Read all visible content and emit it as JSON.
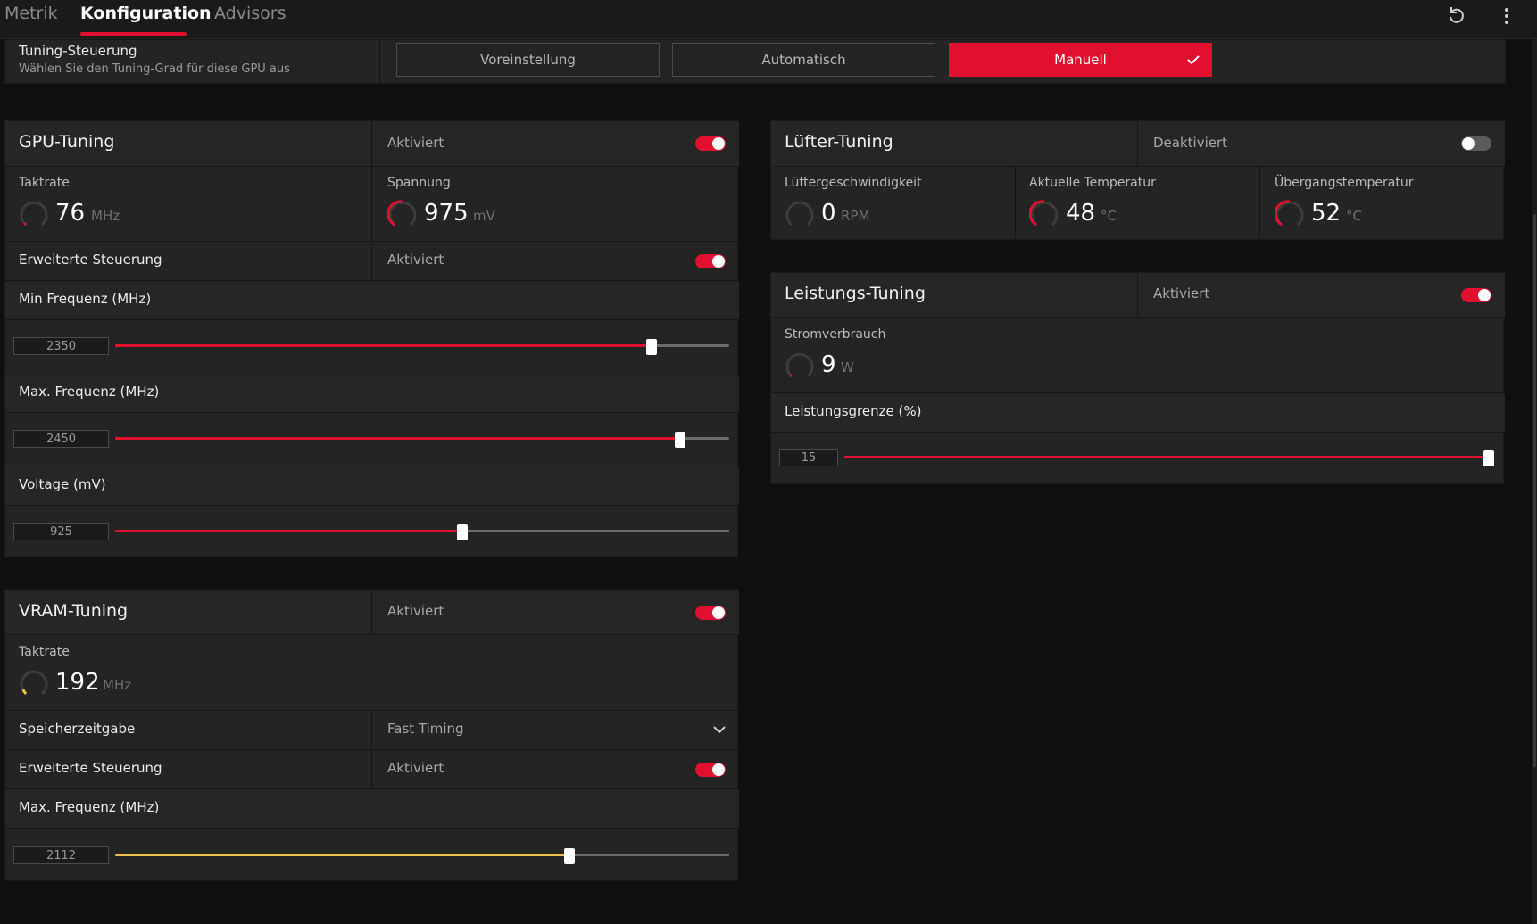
{
  "tabs": [
    {
      "label": "Metrik",
      "active": false
    },
    {
      "label": "Konfiguration",
      "active": true
    },
    {
      "label": "Advisors",
      "active": false
    }
  ],
  "top_icons": [
    "reset-icon",
    "more-vertical-icon"
  ],
  "tuning_control": {
    "title": "Tuning-Steuerung",
    "subtitle": "Wählen Sie den Tuning-Grad für diese GPU aus",
    "options": [
      "Voreinstellung",
      "Automatisch",
      "Manuell"
    ],
    "selected": "Manuell"
  },
  "gpu_tuning": {
    "title": "GPU-Tuning",
    "status": "Aktiviert",
    "enabled": true,
    "clock": {
      "label": "Taktrate",
      "value": "76",
      "unit": "MHz",
      "level": 0.03
    },
    "voltage": {
      "label": "Spannung",
      "value": "975",
      "unit": "mV",
      "level": 0.5
    },
    "advanced": {
      "label": "Erweiterte Steuerung",
      "status": "Aktiviert",
      "enabled": true
    },
    "min_freq": {
      "label": "Min Frequenz (MHz)",
      "value": "2350",
      "fraction": 0.873
    },
    "max_freq": {
      "label": "Max. Frequenz (MHz)",
      "value": "2450",
      "fraction": 0.92
    },
    "voltage_slider": {
      "label": "Voltage (mV)",
      "value": "925",
      "fraction": 0.565
    }
  },
  "vram_tuning": {
    "title": "VRAM-Tuning",
    "status": "Aktiviert",
    "enabled": true,
    "clock": {
      "label": "Taktrate",
      "value": "192",
      "unit": "MHz",
      "level": 0.08
    },
    "memory_timing": {
      "label": "Speicherzeitgabe",
      "value": "Fast Timing"
    },
    "advanced": {
      "label": "Erweiterte Steuerung",
      "status": "Aktiviert",
      "enabled": true
    },
    "max_freq": {
      "label": "Max. Frequenz (MHz)",
      "value": "2112",
      "fraction": 0.74
    }
  },
  "fan_tuning": {
    "title": "Lüfter-Tuning",
    "status": "Deaktiviert",
    "enabled": false,
    "fan_speed": {
      "label": "Lüftergeschwindigkeit",
      "value": "0",
      "unit": "RPM",
      "level": 0
    },
    "current_temp": {
      "label": "Aktuelle Temperatur",
      "value": "48",
      "unit": "°C",
      "level": 0.5
    },
    "junction_temp": {
      "label": "Übergangstemperatur",
      "value": "52",
      "unit": "°C",
      "level": 0.5
    }
  },
  "power_tuning": {
    "title": "Leistungs-Tuning",
    "status": "Aktiviert",
    "enabled": true,
    "power_draw": {
      "label": "Stromverbrauch",
      "value": "9",
      "unit": "W",
      "level": 0.02
    },
    "power_limit": {
      "label": "Leistungsgrenze (%)",
      "value": "15",
      "fraction": 1.0
    }
  },
  "colors": {
    "accent": "#e0102e",
    "vram_accent": "#e8c24a",
    "panel": "#242424",
    "background": "#101010"
  }
}
